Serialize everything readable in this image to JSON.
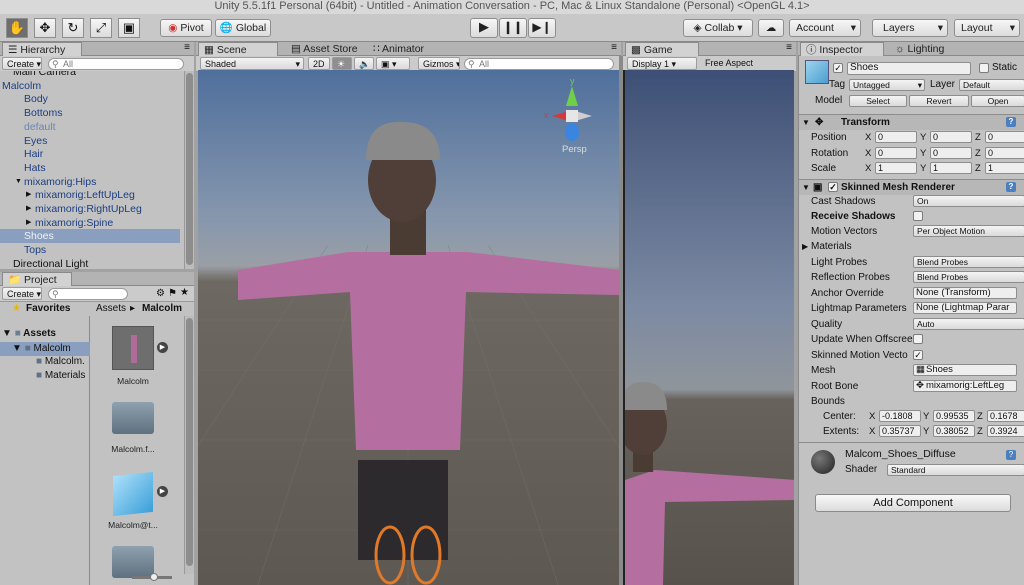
{
  "window": {
    "title": "Unity 5.5.1f1 Personal (64bit) - Untitled - Animation Conversation - PC, Mac & Linux Standalone (Personal) <OpenGL 4.1>"
  },
  "toolbar": {
    "pivot": "Pivot",
    "global": "Global",
    "collab": "Collab ▾",
    "account": "Account",
    "layers": "Layers",
    "layout": "Layout"
  },
  "hierarchy": {
    "tab": "Hierarchy",
    "create": "Create",
    "search_placeholder": "All",
    "items": [
      {
        "label": "Main Camera",
        "indent": 1,
        "arrow": "",
        "selected": false,
        "prefab": false
      },
      {
        "label": "Malcolm",
        "indent": 0,
        "arrow": "▼",
        "selected": false,
        "prefab": true
      },
      {
        "label": "Body",
        "indent": 2,
        "arrow": "",
        "selected": false,
        "prefab": true
      },
      {
        "label": "Bottoms",
        "indent": 2,
        "arrow": "",
        "selected": false,
        "prefab": true
      },
      {
        "label": "default",
        "indent": 2,
        "arrow": "",
        "selected": false,
        "prefab": true
      },
      {
        "label": "Eyes",
        "indent": 2,
        "arrow": "",
        "selected": false,
        "prefab": true
      },
      {
        "label": "Hair",
        "indent": 2,
        "arrow": "",
        "selected": false,
        "prefab": true
      },
      {
        "label": "Hats",
        "indent": 2,
        "arrow": "",
        "selected": false,
        "prefab": true
      },
      {
        "label": "mixamorig:Hips",
        "indent": 2,
        "arrow": "▼",
        "selected": false,
        "prefab": true
      },
      {
        "label": "mixamorig:LeftUpLeg",
        "indent": 3,
        "arrow": "▶",
        "selected": false,
        "prefab": true
      },
      {
        "label": "mixamorig:RightUpLeg",
        "indent": 3,
        "arrow": "▶",
        "selected": false,
        "prefab": true
      },
      {
        "label": "mixamorig:Spine",
        "indent": 3,
        "arrow": "▶",
        "selected": false,
        "prefab": true
      },
      {
        "label": "Shoes",
        "indent": 2,
        "arrow": "",
        "selected": true,
        "prefab": true
      },
      {
        "label": "Tops",
        "indent": 2,
        "arrow": "",
        "selected": false,
        "prefab": true
      },
      {
        "label": "Directional Light",
        "indent": 1,
        "arrow": "",
        "selected": false,
        "prefab": false
      }
    ]
  },
  "project": {
    "tab": "Project",
    "create": "Create",
    "favorites": "Favorites",
    "assets": "Assets",
    "folder": "Malcolm",
    "subfolders": [
      "Malcolm.",
      "Materials"
    ],
    "breadcrumb": [
      "Assets",
      "▸",
      "Malcolm"
    ],
    "items": [
      "Malcolm",
      "Malcolm.f...",
      "Malcolm@t...",
      ""
    ]
  },
  "scene": {
    "tabs": [
      "Scene",
      "Asset Store",
      "Animator"
    ],
    "shaded": "Shaded",
    "mode_2d": "2D",
    "gizmos": "Gizmos",
    "search_placeholder": "All",
    "persp": "Persp",
    "gizmo_x": "x",
    "gizmo_y": "y"
  },
  "game": {
    "tab": "Game",
    "display": "Display 1",
    "aspect": "Free Aspect"
  },
  "inspector": {
    "tabs": [
      "Inspector",
      "Lighting"
    ],
    "object_name": "Shoes",
    "static_label": "Static",
    "tag_label": "Tag",
    "tag_value": "Untagged",
    "layer_label": "Layer",
    "layer_value": "Default",
    "model_label": "Model",
    "model_buttons": [
      "Select",
      "Revert",
      "Open"
    ],
    "transform": {
      "title": "Transform",
      "rows": [
        {
          "label": "Position",
          "x": "0",
          "y": "0",
          "z": "0"
        },
        {
          "label": "Rotation",
          "x": "0",
          "y": "0",
          "z": "0"
        },
        {
          "label": "Scale",
          "x": "1",
          "y": "1",
          "z": "1"
        }
      ]
    },
    "smr": {
      "title": "Skinned Mesh Renderer",
      "cast_shadows": {
        "label": "Cast Shadows",
        "value": "On"
      },
      "receive_shadows": {
        "label": "Receive Shadows"
      },
      "motion_vectors": {
        "label": "Motion Vectors",
        "value": "Per Object Motion"
      },
      "materials": {
        "label": "Materials"
      },
      "light_probes": {
        "label": "Light Probes",
        "value": "Blend Probes"
      },
      "reflection_probes": {
        "label": "Reflection Probes",
        "value": "Blend Probes"
      },
      "anchor_override": {
        "label": "Anchor Override",
        "value": "None (Transform)"
      },
      "lightmap_params": {
        "label": "Lightmap Parameters",
        "value": "None (Lightmap Parar"
      },
      "quality": {
        "label": "Quality",
        "value": "Auto"
      },
      "update_offscreen": {
        "label": "Update When Offscree"
      },
      "skinned_motion": {
        "label": "Skinned Motion Vecto"
      },
      "mesh": {
        "label": "Mesh",
        "value": "Shoes"
      },
      "root_bone": {
        "label": "Root Bone",
        "value": "mixamorig:LeftLeg"
      },
      "bounds": {
        "label": "Bounds"
      },
      "center": {
        "label": "Center:",
        "x": "-0.1808",
        "y": "0.99535",
        "z": "0.1678"
      },
      "extents": {
        "label": "Extents:",
        "x": "0.35737",
        "y": "0.38052",
        "z": "0.3924"
      }
    },
    "material": {
      "name": "Malcom_Shoes_Diffuse",
      "shader_label": "Shader",
      "shader_value": "Standard"
    },
    "add_component": "Add Component",
    "axis_x": "X",
    "axis_y": "Y",
    "axis_z": "Z"
  }
}
